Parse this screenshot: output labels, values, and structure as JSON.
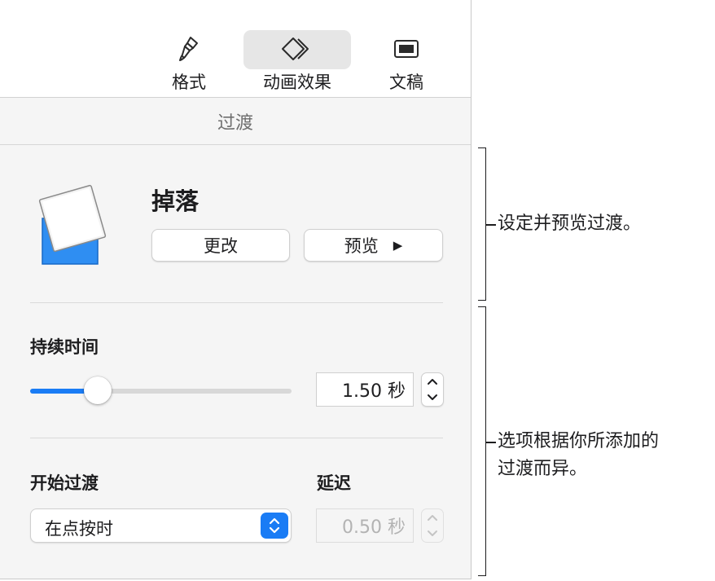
{
  "toolbar": {
    "format_label": "格式",
    "animate_label": "动画效果",
    "document_label": "文稿",
    "selected_tab": "animate"
  },
  "section": {
    "title": "过渡"
  },
  "transition": {
    "name": "掉落",
    "change_label": "更改",
    "preview_label": "预览",
    "preview_icon": "play-icon",
    "thumbnail_icon": "drop-transition-icon"
  },
  "duration": {
    "label": "持续时间",
    "value": "1.50 秒",
    "slider_fraction": 0.26
  },
  "start": {
    "label": "开始过渡",
    "selected": "在点按时"
  },
  "delay": {
    "label": "延迟",
    "value": "0.50 秒",
    "disabled": true
  },
  "annotations": {
    "top": "设定并预览过渡。",
    "bottom_line1": "选项根据你所添加的",
    "bottom_line2": "过渡而异。"
  },
  "colors": {
    "accent": "#1a7cf5",
    "panel_bg": "#f5f5f5",
    "thumbnail_blue": "#2f8ef2"
  }
}
